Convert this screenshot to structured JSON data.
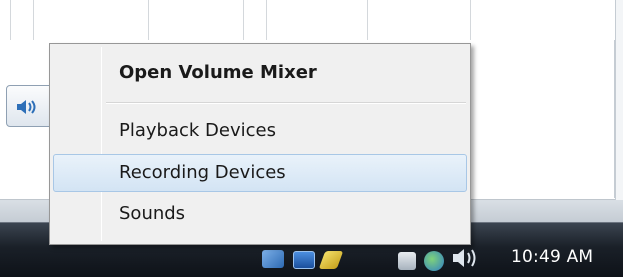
{
  "context_menu": {
    "items": [
      {
        "label": "Open Volume Mixer"
      },
      {
        "label": "Playback Devices"
      },
      {
        "label": "Recording Devices"
      },
      {
        "label": "Sounds"
      }
    ],
    "highlighted_item": "Recording Devices"
  },
  "taskbar": {
    "clock": "10:49 AM",
    "tray_icons": [
      "network-icon",
      "monitor-icon",
      "pen-icon",
      "document-icon",
      "globe-icon",
      "volume-icon"
    ]
  },
  "colors": {
    "menu_background": "#f0f0f0",
    "menu_highlight": "#d3e4f4",
    "taskbar": "#1a2028"
  }
}
